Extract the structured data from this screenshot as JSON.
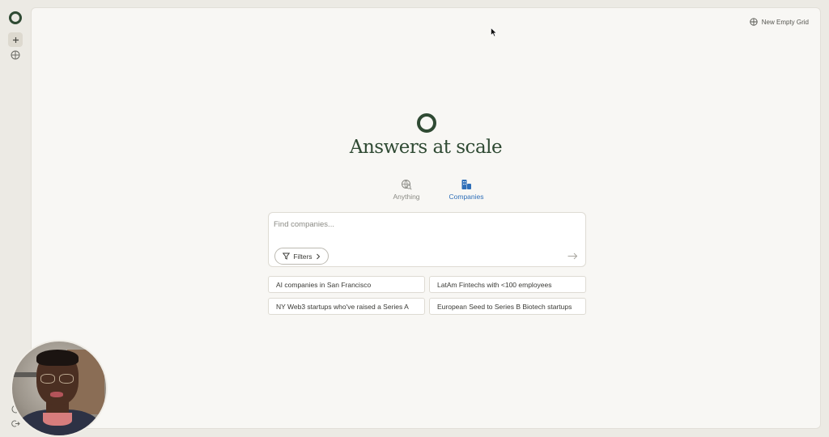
{
  "sidebar": {
    "new_icon": "plus-icon",
    "grid_icon": "grid-icon"
  },
  "header": {
    "new_grid_label": "New Empty Grid"
  },
  "hero": {
    "title": "Answers at scale"
  },
  "tabs": [
    {
      "label": "Anything",
      "icon": "globe-search-icon",
      "active": false
    },
    {
      "label": "Companies",
      "icon": "building-icon",
      "active": true
    }
  ],
  "search": {
    "placeholder": "Find companies...",
    "value": "",
    "filters_label": "Filters"
  },
  "suggestions": [
    "AI companies in San Francisco",
    "LatAm Fintechs with <100 employees",
    "NY Web3 startups who've raised a Series A",
    "European Seed to Series B Biotech startups"
  ],
  "colors": {
    "brand": "#2f4a33",
    "accent": "#2f6fb8",
    "background": "#f8f7f4"
  }
}
